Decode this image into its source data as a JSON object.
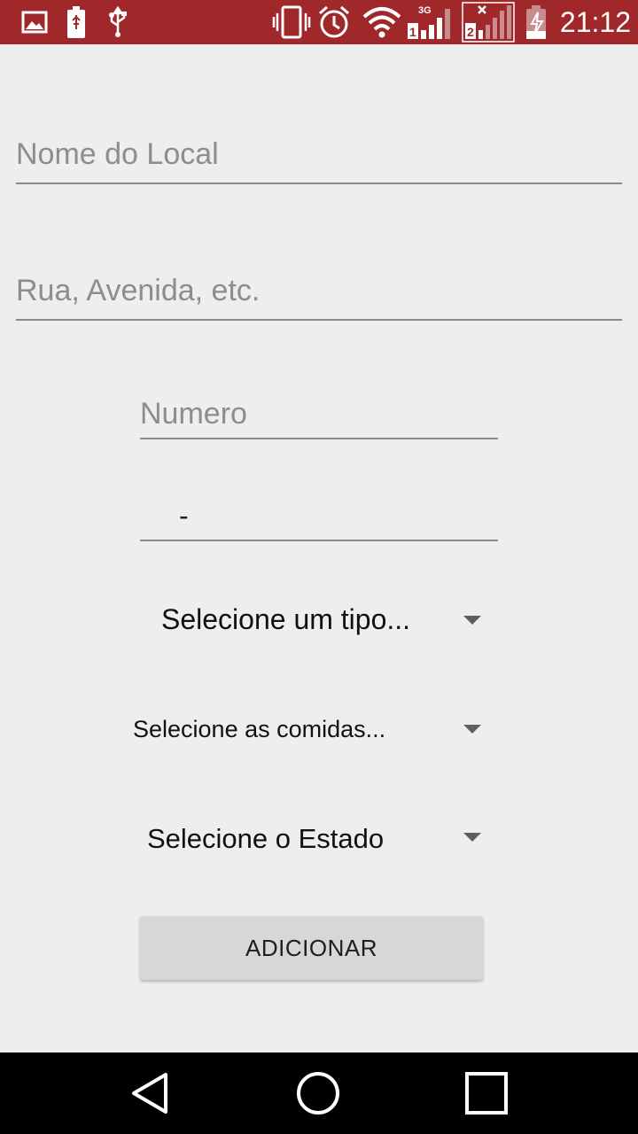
{
  "status_bar": {
    "time": "21:12",
    "background": "#a0282b",
    "icons": [
      "image-icon",
      "battery-usb-icon",
      "usb-icon",
      "vibrate-icon",
      "alarm-icon",
      "wifi-icon",
      "signal-sim1-3g-icon",
      "signal-sim2-icon",
      "battery-charging-icon"
    ],
    "network_label": "3G",
    "sim1_label": "1",
    "sim2_label": "2"
  },
  "form": {
    "nome_local": {
      "value": "",
      "placeholder": "Nome do Local"
    },
    "rua": {
      "value": "",
      "placeholder": "Rua, Avenida, etc."
    },
    "numero": {
      "value": "",
      "placeholder": "Numero"
    },
    "complemento": {
      "value": "-"
    }
  },
  "spinners": {
    "tipo": {
      "label": "Selecione um tipo..."
    },
    "comidas": {
      "label": "Selecione as comidas..."
    },
    "estado": {
      "label": "Selecione o Estado"
    }
  },
  "buttons": {
    "add_label": "ADICIONAR"
  },
  "nav_bar": {
    "icons": [
      "back-icon",
      "home-icon",
      "recents-icon"
    ]
  }
}
